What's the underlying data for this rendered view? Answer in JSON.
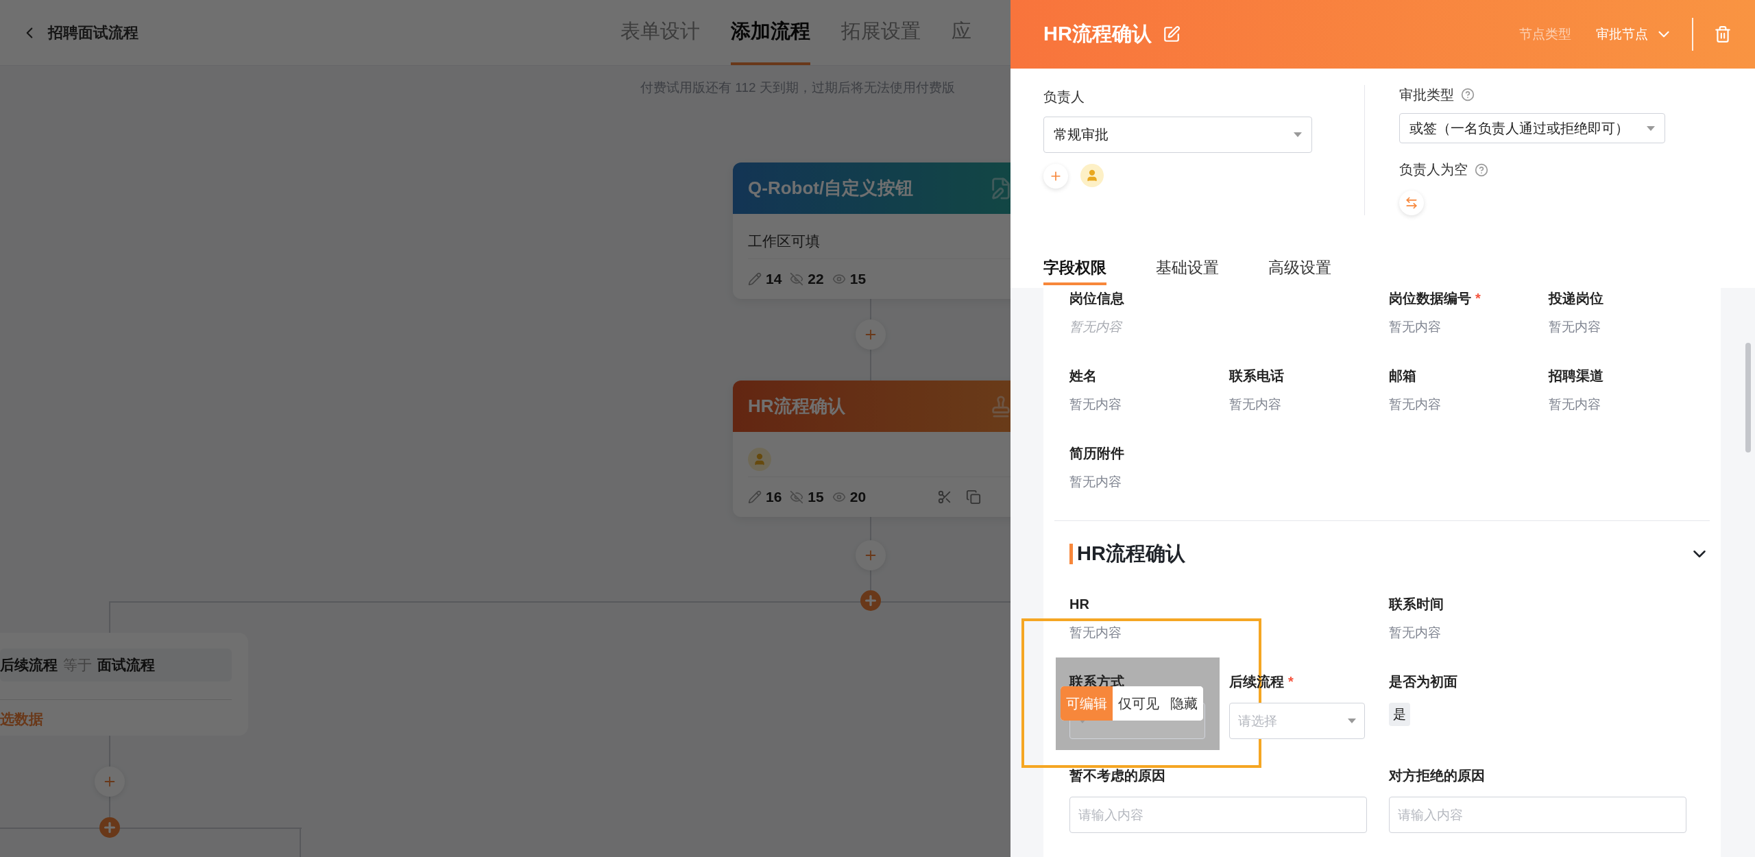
{
  "header": {
    "title": "招聘面试流程",
    "tabs": [
      {
        "label": "表单设计",
        "selected": false
      },
      {
        "label": "添加流程",
        "selected": true
      },
      {
        "label": "拓展设置",
        "selected": false
      },
      {
        "label": "应",
        "selected": false
      }
    ]
  },
  "notice": "付费试用版还有 112 天到期，过期后将无法使用付费版",
  "canvas": {
    "nodes": [
      {
        "kind": "action",
        "title": "Q-Robot/自定义按钮",
        "body": "工作区可填",
        "stats": [
          "14",
          "22",
          "15"
        ]
      },
      {
        "kind": "approval",
        "title": "HR流程确认",
        "stats": [
          "16",
          "15",
          "20"
        ]
      }
    ],
    "condition": {
      "field": "后续流程",
      "operator": "等于",
      "value": "面试流程",
      "link": "选数据"
    }
  },
  "panel": {
    "title": "HR流程确认",
    "node_type_label": "节点类型",
    "node_type": "审批节点",
    "owner": {
      "label": "负责人",
      "value": "常规审批"
    },
    "approval_type": {
      "label": "审批类型",
      "value": "或签（一名负责人通过或拒绝即可）"
    },
    "empty_owner": {
      "label": "负责人为空"
    },
    "tabs": [
      {
        "label": "字段权限",
        "selected": true
      },
      {
        "label": "基础设置",
        "selected": false
      },
      {
        "label": "高级设置",
        "selected": false
      }
    ],
    "sections": [
      {
        "rows": [
          [
            {
              "kind": "text",
              "label": "岗位信息",
              "value": "暂无内容",
              "muted": true
            },
            null,
            {
              "kind": "text",
              "label": "岗位数据编号",
              "required_mark": "*",
              "value": "暂无内容",
              "muted": false
            },
            {
              "kind": "text",
              "label": "投递岗位",
              "value": "暂无内容",
              "muted": false
            }
          ],
          [
            {
              "kind": "text",
              "label": "姓名",
              "value": "暂无内容",
              "muted": false
            },
            {
              "kind": "text",
              "label": "联系电话",
              "value": "暂无内容",
              "muted": false
            },
            {
              "kind": "text",
              "label": "邮箱",
              "value": "暂无内容",
              "muted": false
            },
            {
              "kind": "text",
              "label": "招聘渠道",
              "value": "暂无内容",
              "muted": false
            }
          ],
          [
            {
              "kind": "text",
              "label": "简历附件",
              "value": "暂无内容",
              "muted": false
            }
          ]
        ]
      },
      {
        "title": "HR流程确认",
        "expanded": true,
        "rows": [
          [
            {
              "kind": "text",
              "label": "HR",
              "value": "暂无内容",
              "muted": false
            },
            null,
            {
              "kind": "text",
              "label": "联系时间",
              "value": "暂无内容",
              "muted": false
            }
          ],
          [
            {
              "kind": "select",
              "label": "联系方式",
              "permission_menu": [
                {
                  "label": "可编辑",
                  "selected": true
                },
                {
                  "label": "仅可见",
                  "selected": false
                },
                {
                  "label": "隐藏",
                  "selected": false
                }
              ]
            },
            {
              "kind": "select",
              "label": "后续流程",
              "required_mark": "*",
              "placeholder": "请选择"
            },
            {
              "kind": "tag",
              "label": "是否为初面",
              "value": "是"
            }
          ],
          [
            {
              "kind": "input",
              "label": "暂不考虑的原因",
              "placeholder": "请输入内容"
            },
            null,
            {
              "kind": "input",
              "label": "对方拒绝的原因",
              "placeholder": "请输入内容"
            }
          ]
        ]
      }
    ]
  }
}
